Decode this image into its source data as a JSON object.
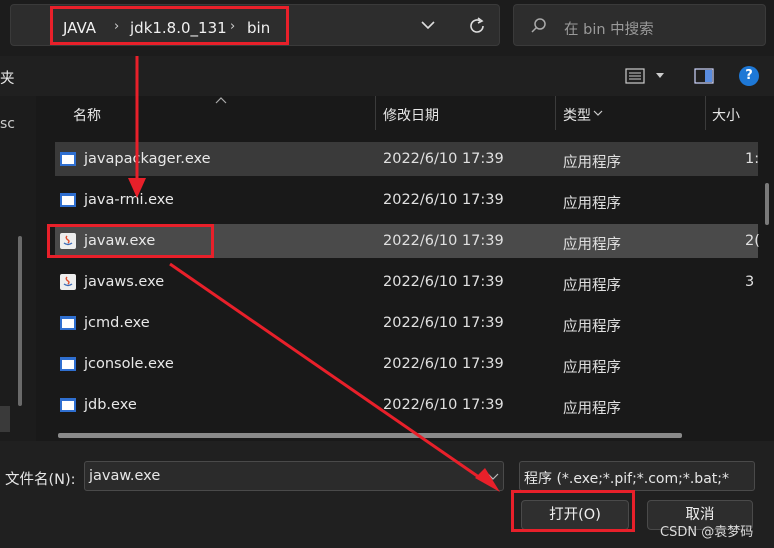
{
  "breadcrumb": {
    "items": [
      "JAVA",
      "jdk1.8.0_131",
      "bin"
    ]
  },
  "search": {
    "placeholder": "在 bin 中搜索"
  },
  "toolbar": {
    "left_label": "夹"
  },
  "left_pane": {
    "label": "sc"
  },
  "columns": {
    "name": "名称",
    "date": "修改日期",
    "type": "类型",
    "size": "大小"
  },
  "files": [
    {
      "name": "javapackager.exe",
      "date": "2022/6/10 17:39",
      "type": "应用程序",
      "size": "1:",
      "icon": "exe-window-icon"
    },
    {
      "name": "java-rmi.exe",
      "date": "2022/6/10 17:39",
      "type": "应用程序",
      "size": "",
      "icon": "exe-window-icon"
    },
    {
      "name": "javaw.exe",
      "date": "2022/6/10 17:39",
      "type": "应用程序",
      "size": "2(",
      "icon": "java-icon"
    },
    {
      "name": "javaws.exe",
      "date": "2022/6/10 17:39",
      "type": "应用程序",
      "size": "3",
      "icon": "java-icon"
    },
    {
      "name": "jcmd.exe",
      "date": "2022/6/10 17:39",
      "type": "应用程序",
      "size": "",
      "icon": "exe-window-icon"
    },
    {
      "name": "jconsole.exe",
      "date": "2022/6/10 17:39",
      "type": "应用程序",
      "size": "",
      "icon": "exe-window-icon"
    },
    {
      "name": "jdb.exe",
      "date": "2022/6/10 17:39",
      "type": "应用程序",
      "size": "",
      "icon": "exe-window-icon"
    }
  ],
  "bottom": {
    "filename_label": "文件名(N):",
    "filename_value": "javaw.exe",
    "filter_value": "程序 (*.exe;*.pif;*.com;*.bat;*",
    "open_button": "打开(O)",
    "cancel_button": "取消"
  },
  "watermark": "CSDN @袁梦码",
  "colors": {
    "annotation_red": "#e8202a",
    "selected_row": "#4a4a4a",
    "folder_yellow": "#f2c94c"
  }
}
